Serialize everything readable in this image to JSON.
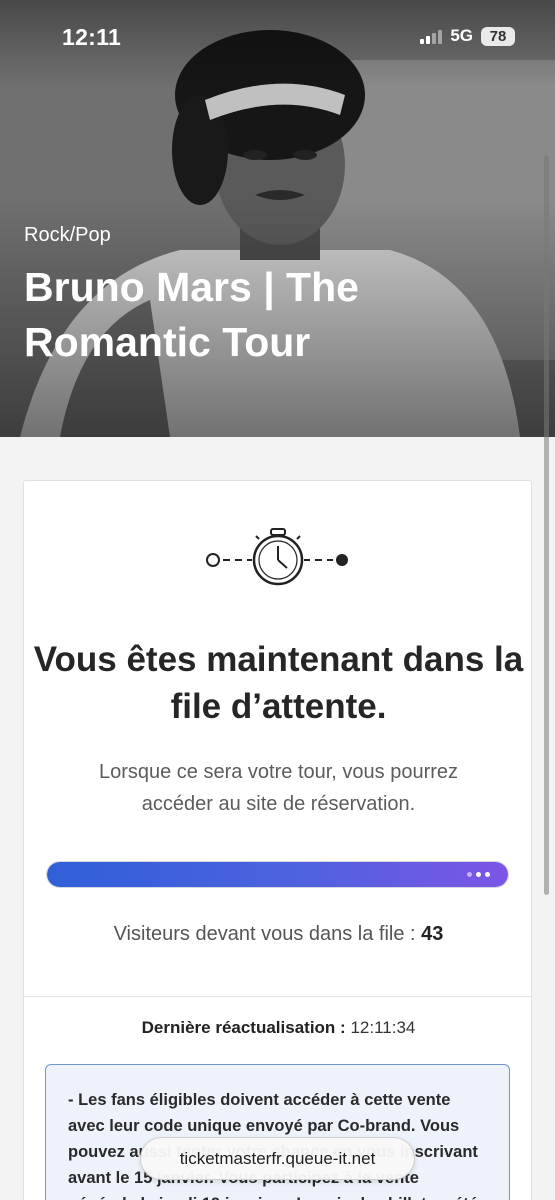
{
  "status_bar": {
    "time": "12:11",
    "network": "5G",
    "battery": "78"
  },
  "hero": {
    "genre": "Rock/Pop",
    "title": "Bruno Mars | The Romantic Tour"
  },
  "queue": {
    "heading": "Vous êtes maintenant dans la file d’attente.",
    "subtext": "Lorsque ce sera votre tour, vous pourrez accéder au site de réservation.",
    "progress_fraction": 1.0,
    "visitors_label": "Visiteurs devant vous dans la file :",
    "visitors_count": "43",
    "refresh_label": "Dernière réactualisation :",
    "refresh_time": "12:11:34",
    "notice": "- Les fans éligibles doivent accéder à cette vente avec leur code unique envoyé par Co-brand. Vous pouvez aussi tenter votre chance en vous inscrivant avant le 15 janvier. Vous participez à la vente générale le jeudi 19 janvier. - Le prix des billets a été fixé à l’avance par l’organisateur."
  },
  "url_bar": {
    "url": "ticketmasterfr.queue-it.net"
  },
  "colors": {
    "progress_start": "#2f5fd8",
    "progress_end": "#7c55e6",
    "notice_border": "#6f96cf",
    "notice_bg": "#eef3fb"
  }
}
